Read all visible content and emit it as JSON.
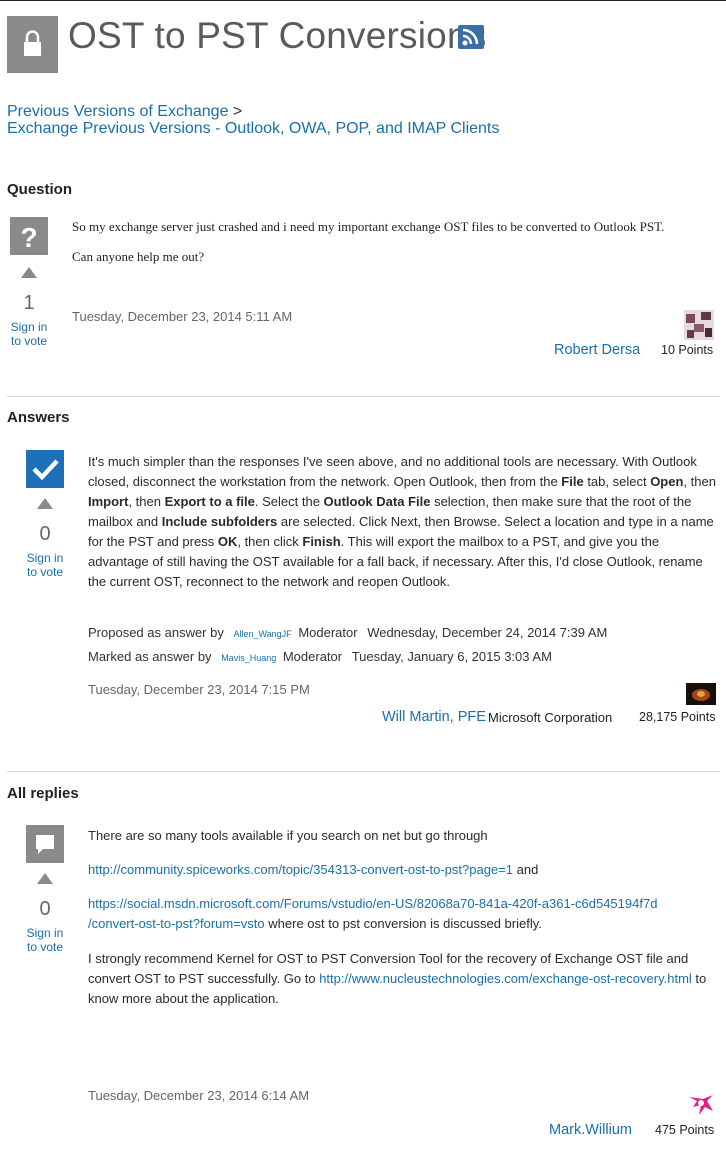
{
  "page": {
    "title": "OST to PST Conversions",
    "breadcrumb": [
      "Previous Versions of Exchange",
      ">",
      "Exchange Previous Versions - Outlook, OWA, POP, and IMAP Clients"
    ]
  },
  "question": {
    "heading": "Question",
    "text1": "So my exchange server just crashed and i need my important exchange OST files to be converted to Outlook PST.",
    "text2": "Can anyone help me out?",
    "votes": "1",
    "signin": "Sign in",
    "tovote": "to vote",
    "date": "Tuesday, December 23, 2014 5:11 AM",
    "user": "Robert Dersa",
    "points": "10 Points"
  },
  "answers": {
    "heading": "Answers",
    "votes": "0",
    "signin": "Sign in",
    "tovote": "to vote",
    "p": [
      "It's much simpler than the responses I've seen above, and no additional tools are necessary.  With Outlook closed, disconnect the workstation from the network.  Open Outlook, then from the ",
      "File",
      " tab, select ",
      "Open",
      ", then ",
      "Import",
      ", then ",
      "Export to a file",
      ".  Select the ",
      "Outlook Data File",
      " selection, then make sure that the root of the mailbox and ",
      "Include subfolders",
      " are selected. Click Next, then Browse.  Select a location and type in a name for the PST and press ",
      "OK",
      ", then click ",
      "Finish",
      ".  This will export the mailbox to a PST, and give you the advantage of still having the OST available for a fall back, if necessary. After this, I'd close Outlook, rename the current OST, reconnect to the network and reopen Outlook."
    ],
    "proposed_label": "Proposed as answer by",
    "proposed_user": "Allen_WangJF",
    "proposed_role": "Moderator",
    "proposed_date": "Wednesday, December 24, 2014 7:39 AM",
    "marked_label": "Marked as answer by",
    "marked_user": "Mavis_Huang",
    "marked_role": "Moderator",
    "marked_date": "Tuesday, January 6, 2015 3:03 AM",
    "date": "Tuesday, December 23, 2014 7:15 PM",
    "user": "Will Martin, PFE",
    "company": "Microsoft Corporation",
    "points": "28,175 Points"
  },
  "replies": {
    "heading": "All replies",
    "votes": "0",
    "signin": "Sign in",
    "tovote": "to vote",
    "line1": "There are so many tools available if you search on net but go through",
    "link1": "http://community.spiceworks.com/topic/354313-convert-ost-to-pst?page=1",
    "and": " and",
    "link2a": "https://social.msdn.microsoft.com/Forums/vstudio/en-US/82068a70-841a-420f-a361-c6d545194f7d",
    "link2b": "/convert-ost-to-pst?forum=vsto",
    "after2": " where ost to pst conversion is discussed briefly.",
    "para3a": "I strongly recommend Kernel for OST to PST Conversion Tool for the recovery of Exchange OST file and convert OST to PST successfully. Go to ",
    "link3": "http://www.nucleustechnologies.com/exchange-ost-recovery.html",
    "para3b": " to know more about the application.",
    "date": "Tuesday, December 23, 2014 6:14 AM",
    "user": "Mark.Willium",
    "points": "475 Points"
  },
  "colors": {
    "accent": "#1a6fa9",
    "answer_check": "#1e6fb8",
    "gray_icon": "#8a8a8a"
  }
}
